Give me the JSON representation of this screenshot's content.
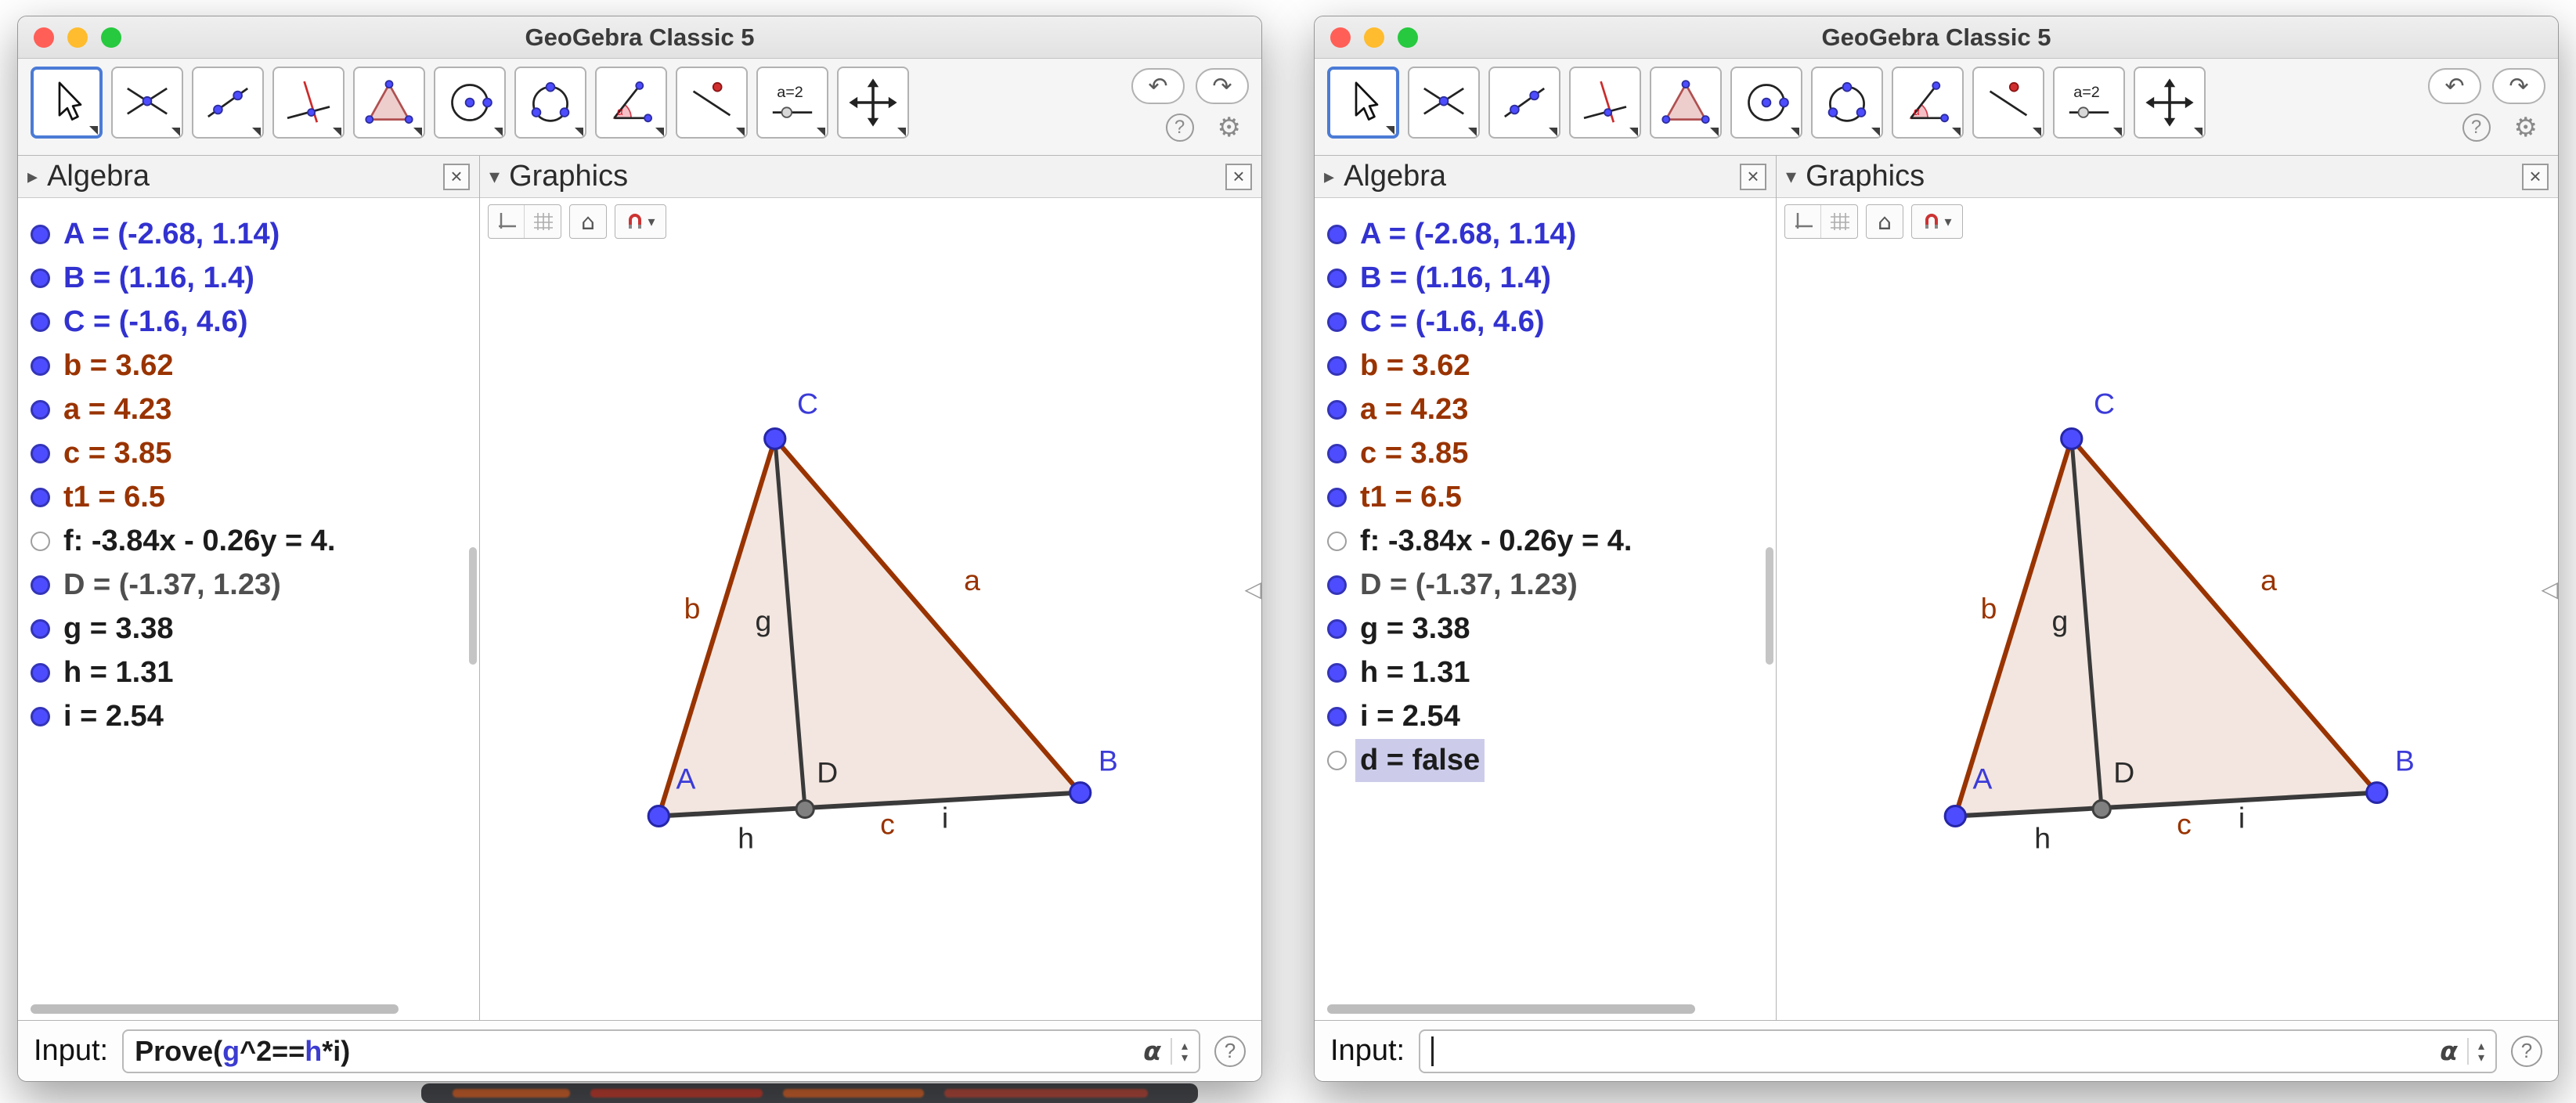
{
  "chrome": {
    "title": "GeoGebra Classic 5"
  },
  "icons": {
    "disclosure_closed": "▸",
    "disclosure_open": "▾",
    "close": "×",
    "undo": "↶",
    "redo": "↷",
    "help": "?",
    "gear": "⚙",
    "home": "⌂",
    "collapse_left": "◁",
    "alpha": "α",
    "stepper_up": "▴",
    "stepper_down": "▾",
    "caret_down": "▾"
  },
  "toolbar": {
    "slider_label": "a=2",
    "tools": [
      "move-tool",
      "point-tool",
      "line-tool",
      "perpendicular-line-tool",
      "polygon-tool",
      "circle-tool",
      "circle-three-points-tool",
      "angle-tool",
      "reflection-tool",
      "slider-tool",
      "move-graphics-view-tool"
    ]
  },
  "panels": {
    "algebra_title": "Algebra",
    "graphics_title": "Graphics"
  },
  "graphics": {
    "labels": {
      "A": "A",
      "B": "B",
      "C": "C",
      "D": "D",
      "a": "a",
      "b": "b",
      "c": "c",
      "g": "g",
      "h": "h",
      "i": "i"
    }
  },
  "left_window": {
    "algebra_items": [
      {
        "text": "A = (-2.68, 1.14)",
        "color": "#3232d0",
        "bullet": "bullet-filled"
      },
      {
        "text": "B = (1.16, 1.4)",
        "color": "#3232d0",
        "bullet": "bullet-filled"
      },
      {
        "text": "C = (-1.6, 4.6)",
        "color": "#3232d0",
        "bullet": "bullet-filled"
      },
      {
        "text": "b = 3.62",
        "color": "#993300",
        "bullet": "bullet-filled"
      },
      {
        "text": "a = 4.23",
        "color": "#993300",
        "bullet": "bullet-filled"
      },
      {
        "text": "c = 3.85",
        "color": "#993300",
        "bullet": "bullet-filled"
      },
      {
        "text": "t1 = 6.5",
        "color": "#993300",
        "bullet": "bullet-filled"
      },
      {
        "text": "f: -3.84x - 0.26y = 4.",
        "color": "#1c1c1c",
        "bullet": "bullet-hollow"
      },
      {
        "text": "D = (-1.37, 1.23)",
        "color": "#4f4f4f",
        "bullet": "bullet-filled"
      },
      {
        "text": "g = 3.38",
        "color": "#1c1c1c",
        "bullet": "bullet-filled"
      },
      {
        "text": "h = 1.31",
        "color": "#1c1c1c",
        "bullet": "bullet-filled"
      },
      {
        "text": "i = 2.54",
        "color": "#1c1c1c",
        "bullet": "bullet-filled"
      }
    ],
    "input": {
      "label": "Input:",
      "segments": [
        {
          "t": "Prove(",
          "c": "#1b1b1b"
        },
        {
          "t": "g",
          "c": "#3c3cd0"
        },
        {
          "t": "^2==",
          "c": "#1b1b1b"
        },
        {
          "t": "h",
          "c": "#3c3cd0"
        },
        {
          "t": "*",
          "c": "#1b1b1b"
        },
        {
          "t": "i",
          "c": "#1b1b1b"
        },
        {
          "t": ")",
          "c": "#1b1b1b"
        }
      ]
    }
  },
  "right_window": {
    "algebra_items": [
      {
        "text": "A = (-2.68, 1.14)",
        "color": "#3232d0",
        "bullet": "bullet-filled"
      },
      {
        "text": "B = (1.16, 1.4)",
        "color": "#3232d0",
        "bullet": "bullet-filled"
      },
      {
        "text": "C = (-1.6, 4.6)",
        "color": "#3232d0",
        "bullet": "bullet-filled"
      },
      {
        "text": "b = 3.62",
        "color": "#993300",
        "bullet": "bullet-filled"
      },
      {
        "text": "a = 4.23",
        "color": "#993300",
        "bullet": "bullet-filled"
      },
      {
        "text": "c = 3.85",
        "color": "#993300",
        "bullet": "bullet-filled"
      },
      {
        "text": "t1 = 6.5",
        "color": "#993300",
        "bullet": "bullet-filled"
      },
      {
        "text": "f: -3.84x - 0.26y = 4.",
        "color": "#1c1c1c",
        "bullet": "bullet-hollow"
      },
      {
        "text": "D = (-1.37, 1.23)",
        "color": "#4f4f4f",
        "bullet": "bullet-filled"
      },
      {
        "text": "g = 3.38",
        "color": "#1c1c1c",
        "bullet": "bullet-filled"
      },
      {
        "text": "h = 1.31",
        "color": "#1c1c1c",
        "bullet": "bullet-filled"
      },
      {
        "text": "i = 2.54",
        "color": "#1c1c1c",
        "bullet": "bullet-filled"
      },
      {
        "text": "d = false",
        "color": "#1c1c1c",
        "bullet": "bullet-hollow",
        "label_class": "label-selected"
      }
    ],
    "input": {
      "label": "Input:",
      "segments": []
    }
  }
}
